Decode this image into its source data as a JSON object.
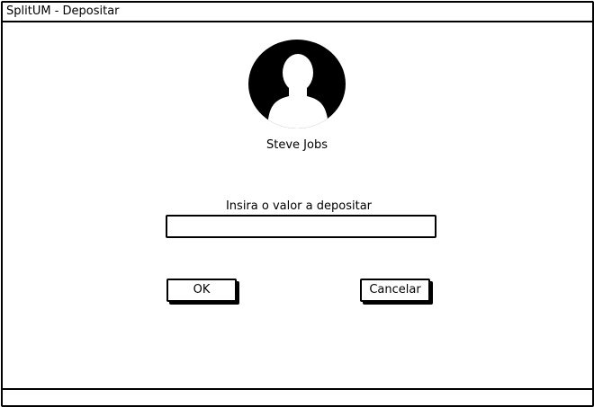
{
  "window": {
    "title": "SplitUM - Depositar"
  },
  "user": {
    "avatar_icon": "user-avatar-icon",
    "name": "Steve Jobs"
  },
  "deposit": {
    "prompt": "Insira o valor a depositar",
    "amount_value": "",
    "amount_placeholder": ""
  },
  "actions": {
    "ok_label": "OK",
    "cancel_label": "Cancelar"
  },
  "colors": {
    "ink": "#000000",
    "background": "#ffffff"
  }
}
